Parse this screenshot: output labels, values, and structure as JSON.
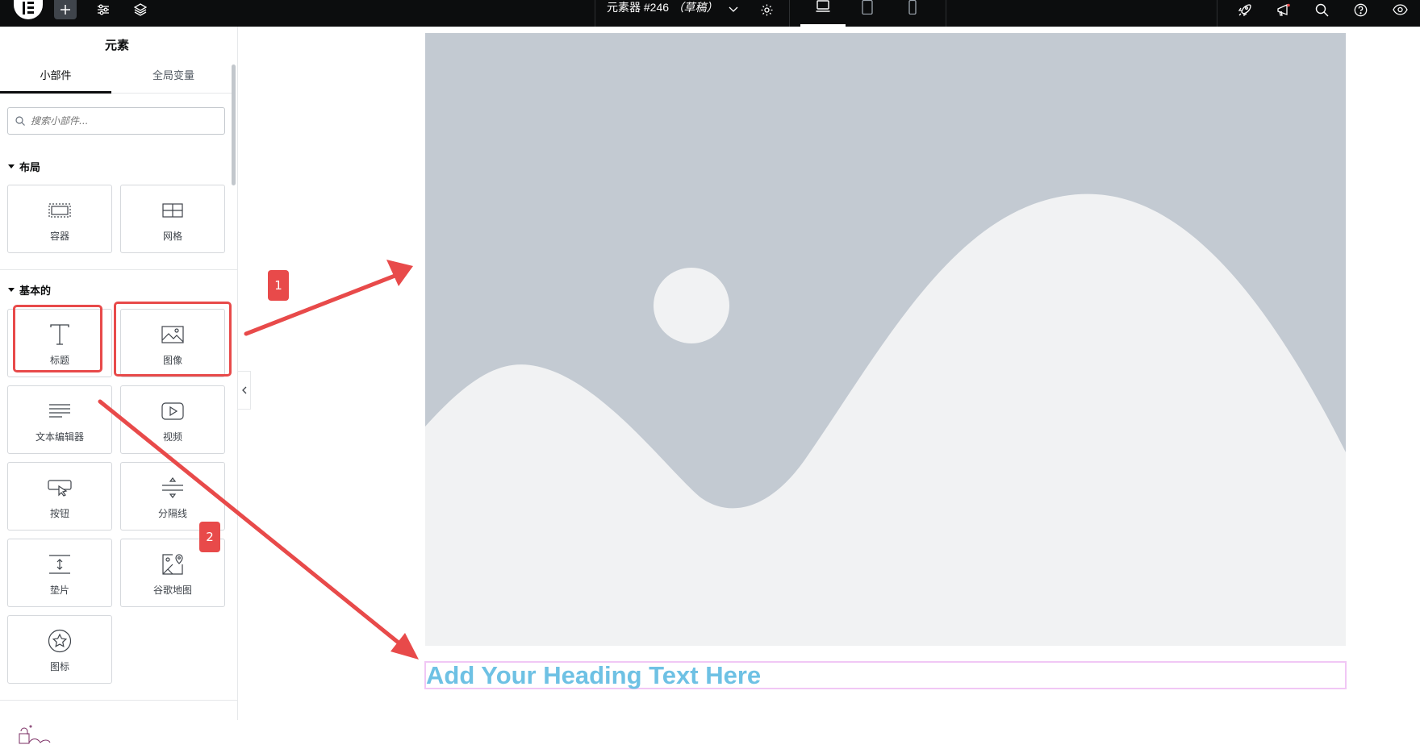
{
  "topbar": {
    "document_title": "元素器 #246",
    "draft_label": "（草稿）"
  },
  "panel": {
    "title": "元素",
    "tabs": [
      {
        "label": "小部件",
        "active": true
      },
      {
        "label": "全局变量",
        "active": false
      }
    ],
    "search_placeholder": "搜索小部件...",
    "categories": [
      {
        "label": "布局",
        "widgets": [
          {
            "label": "容器",
            "icon": "container-icon"
          },
          {
            "label": "网格",
            "icon": "grid-icon"
          }
        ]
      },
      {
        "label": "基本的",
        "widgets": [
          {
            "label": "标题",
            "icon": "heading-icon"
          },
          {
            "label": "图像",
            "icon": "image-icon"
          },
          {
            "label": "文本编辑器",
            "icon": "text-editor-icon"
          },
          {
            "label": "视频",
            "icon": "video-icon"
          },
          {
            "label": "按钮",
            "icon": "button-icon"
          },
          {
            "label": "分隔线",
            "icon": "divider-icon"
          },
          {
            "label": "垫片",
            "icon": "spacer-icon"
          },
          {
            "label": "谷歌地图",
            "icon": "google-maps-icon"
          },
          {
            "label": "图标",
            "icon": "star-icon"
          }
        ]
      }
    ]
  },
  "canvas": {
    "heading_text": "Add Your Heading Text Here"
  },
  "annotations": {
    "badge_1": "1",
    "badge_2": "2"
  },
  "colors": {
    "topbar": "#0c0d0e",
    "accent_red": "#e84a4a",
    "heading": "#6ec1e4",
    "placeholder_bg": "#c3cad2",
    "placeholder_fg": "#f1f2f3"
  }
}
